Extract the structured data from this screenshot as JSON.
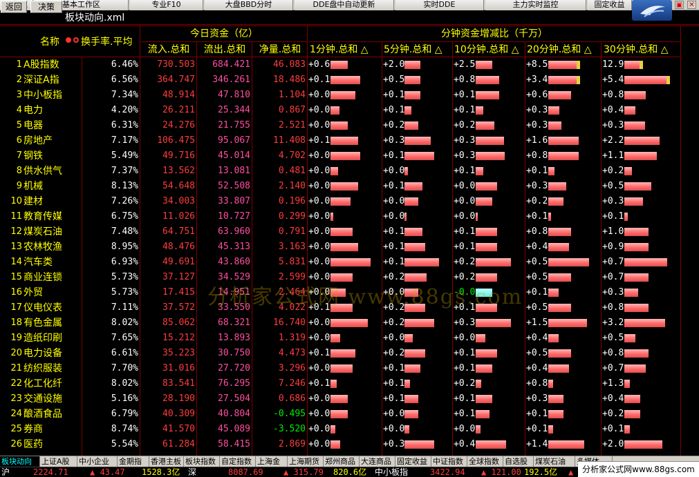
{
  "top_tabs": [
    "工作区",
    "基本工作区",
    "专业F10",
    "大盘BBD分时",
    "DDE盘中自动更新",
    "实时DDE",
    "主力实时监控",
    "固定收益"
  ],
  "toolbar": {
    "back": "返回",
    "strategy": "决策",
    "filename": "板块动向.xml"
  },
  "header": {
    "name": "名称",
    "turnover": "换手率.平均",
    "group_today": "今日资金（亿）",
    "inflow": "流入.总和",
    "outflow": "流出.总和",
    "net": "净量.总和",
    "group_minute": "分钟资金增减比（千万）",
    "m1": "1分钟.总和 △",
    "m5": "5分钟.总和 △",
    "m10": "10分钟.总和 △",
    "m20": "20分钟.总和 △",
    "m30": "30分钟.总和 △"
  },
  "rows": [
    {
      "idx": "1",
      "name": "A股指数",
      "turn": "6.46%",
      "in": "730.503",
      "out": "684.421",
      "net": "46.083",
      "d": [
        "+0.6",
        "+2.0",
        "+2.5",
        "+8.5",
        "12.9"
      ],
      "b": [
        0.35,
        0.35,
        0.35,
        0.62,
        0.35
      ]
    },
    {
      "idx": "2",
      "name": "深证A指",
      "turn": "6.56%",
      "in": "364.747",
      "out": "346.261",
      "net": "18.486",
      "d": [
        "+0.1",
        "+0.5",
        "+0.8",
        "+3.4",
        "+5.4"
      ],
      "b": [
        0.6,
        0.35,
        0.5,
        0.62,
        0.85
      ]
    },
    {
      "idx": "3",
      "name": "中小板指",
      "turn": "7.34%",
      "in": "48.914",
      "out": "47.810",
      "net": "1.104",
      "d": [
        "+0.0",
        "+0.1",
        "+0.1",
        "+0.6",
        "+0.8"
      ],
      "b": [
        0.5,
        0.35,
        0.5,
        0.45,
        0.4
      ]
    },
    {
      "idx": "4",
      "name": "电力",
      "turn": "4.20%",
      "in": "26.211",
      "out": "25.344",
      "net": "0.867",
      "d": [
        "+0.0",
        "+0.1",
        "+0.1",
        "+0.3",
        "+0.4"
      ],
      "b": [
        0.18,
        0.15,
        0.16,
        0.22,
        0.2
      ]
    },
    {
      "idx": "5",
      "name": "电器",
      "turn": "6.31%",
      "in": "24.276",
      "out": "21.755",
      "net": "2.521",
      "d": [
        "+0.0",
        "+0.2",
        "+0.2",
        "+0.3",
        "+0.3"
      ],
      "b": [
        0.35,
        0.3,
        0.4,
        0.25,
        0.38
      ]
    },
    {
      "idx": "6",
      "name": "房地产",
      "turn": "7.17%",
      "in": "106.475",
      "out": "95.067",
      "net": "11.408",
      "d": [
        "+0.1",
        "+0.3",
        "+0.3",
        "+1.6",
        "+2.2"
      ],
      "b": [
        0.55,
        0.58,
        0.6,
        0.6,
        0.65
      ]
    },
    {
      "idx": "7",
      "name": "钢铁",
      "turn": "5.49%",
      "in": "49.716",
      "out": "45.014",
      "net": "4.702",
      "d": [
        "+0.0",
        "+0.1",
        "+0.3",
        "+0.8",
        "+1.1"
      ],
      "b": [
        0.6,
        0.65,
        0.62,
        0.6,
        0.6
      ]
    },
    {
      "idx": "8",
      "name": "供水供气",
      "turn": "7.37%",
      "in": "13.562",
      "out": "13.081",
      "net": "0.481",
      "d": [
        "+0.0",
        "+0.0",
        "+0.1",
        "+0.1",
        "+0.2"
      ],
      "b": [
        0.15,
        0.08,
        0.16,
        0.12,
        0.14
      ]
    },
    {
      "idx": "9",
      "name": "机械",
      "turn": "8.13%",
      "in": "54.648",
      "out": "52.508",
      "net": "2.140",
      "d": [
        "+0.0",
        "+0.1",
        "+0.0",
        "+0.3",
        "+0.5"
      ],
      "b": [
        0.55,
        0.4,
        0.45,
        0.35,
        0.5
      ]
    },
    {
      "idx": "10",
      "name": "建材",
      "turn": "7.26%",
      "in": "34.003",
      "out": "33.807",
      "net": "0.196",
      "d": [
        "+0.0",
        "+0.0",
        "+0.0",
        "+0.2",
        "+0.3"
      ],
      "b": [
        0.4,
        0.3,
        0.35,
        0.3,
        0.35
      ]
    },
    {
      "idx": "11",
      "name": "教育传媒",
      "turn": "6.75%",
      "in": "11.026",
      "out": "10.727",
      "net": "0.299",
      "d": [
        "+0.0",
        "+0.0",
        "+0.0",
        "+0.1",
        "+0.1"
      ],
      "b": [
        0.06,
        0.04,
        0.04,
        0.06,
        0.06
      ]
    },
    {
      "idx": "12",
      "name": "煤炭石油",
      "turn": "7.48%",
      "in": "64.751",
      "out": "63.960",
      "net": "0.791",
      "d": [
        "+0.0",
        "+0.1",
        "+0.1",
        "+0.8",
        "+1.0"
      ],
      "b": [
        0.45,
        0.4,
        0.45,
        0.45,
        0.45
      ]
    },
    {
      "idx": "13",
      "name": "农林牧渔",
      "turn": "8.95%",
      "in": "48.476",
      "out": "45.313",
      "net": "3.163",
      "d": [
        "+0.0",
        "+0.1",
        "+0.1",
        "+0.4",
        "+0.9"
      ],
      "b": [
        0.55,
        0.45,
        0.45,
        0.4,
        0.45
      ]
    },
    {
      "idx": "14",
      "name": "汽车类",
      "turn": "6.93%",
      "in": "49.691",
      "out": "43.860",
      "net": "5.831",
      "d": [
        "+0.0",
        "+0.1",
        "+0.2",
        "+0.5",
        "+0.7"
      ],
      "b": [
        0.8,
        0.75,
        0.75,
        0.8,
        0.8
      ]
    },
    {
      "idx": "15",
      "name": "商业连锁",
      "turn": "5.73%",
      "in": "37.127",
      "out": "34.529",
      "net": "2.599",
      "d": [
        "+0.0",
        "+0.2",
        "+0.2",
        "+0.5",
        "+0.7"
      ],
      "b": [
        0.45,
        0.48,
        0.45,
        0.45,
        0.45
      ]
    },
    {
      "idx": "16",
      "name": "外贸",
      "turn": "5.73%",
      "in": "17.415",
      "out": "14.951",
      "net": "2.464",
      "d": [
        "+0.0",
        "+0.0",
        "-0.0",
        "+0.1",
        "+0.3"
      ],
      "b": [
        0.3,
        0.3,
        0.35,
        0.2,
        0.25
      ]
    },
    {
      "idx": "17",
      "name": "仪电仪表",
      "turn": "7.11%",
      "in": "37.572",
      "out": "33.550",
      "net": "4.022",
      "d": [
        "+0.1",
        "+0.2",
        "+0.1",
        "+0.5",
        "+0.8"
      ],
      "b": [
        0.45,
        0.45,
        0.45,
        0.45,
        0.45
      ]
    },
    {
      "idx": "18",
      "name": "有色金属",
      "turn": "8.02%",
      "in": "85.062",
      "out": "68.321",
      "net": "16.740",
      "d": [
        "+0.0",
        "+0.2",
        "+0.3",
        "+1.5",
        "+3.2"
      ],
      "b": [
        0.75,
        0.65,
        0.75,
        0.75,
        0.75
      ]
    },
    {
      "idx": "19",
      "name": "造纸印刷",
      "turn": "7.65%",
      "in": "15.212",
      "out": "13.893",
      "net": "1.319",
      "d": [
        "+0.0",
        "+0.0",
        "+0.0",
        "+0.4",
        "+0.5"
      ],
      "b": [
        0.2,
        0.18,
        0.2,
        0.2,
        0.2
      ]
    },
    {
      "idx": "20",
      "name": "电力设备",
      "turn": "6.61%",
      "in": "35.223",
      "out": "30.750",
      "net": "4.473",
      "d": [
        "+0.1",
        "+0.2",
        "+0.1",
        "+0.5",
        "+0.8"
      ],
      "b": [
        0.5,
        0.45,
        0.45,
        0.45,
        0.45
      ]
    },
    {
      "idx": "21",
      "name": "纺织服装",
      "turn": "7.70%",
      "in": "31.016",
      "out": "27.720",
      "net": "3.296",
      "d": [
        "+0.0",
        "+0.1",
        "+0.1",
        "+0.4",
        "+0.7"
      ],
      "b": [
        0.45,
        0.35,
        0.35,
        0.4,
        0.4
      ]
    },
    {
      "idx": "22",
      "name": "化工化纤",
      "turn": "8.02%",
      "in": "83.541",
      "out": "76.295",
      "net": "7.246",
      "d": [
        "+0.1",
        "+0.1",
        "+0.2",
        "+0.8",
        "+1.3"
      ],
      "b": [
        0.12,
        0.12,
        0.12,
        0.1,
        0.1
      ]
    },
    {
      "idx": "23",
      "name": "交通设施",
      "turn": "5.16%",
      "in": "28.190",
      "out": "27.504",
      "net": "0.686",
      "d": [
        "+0.0",
        "+0.1",
        "+0.1",
        "+0.3",
        "+0.4"
      ],
      "b": [
        0.35,
        0.3,
        0.35,
        0.3,
        0.3
      ]
    },
    {
      "idx": "24",
      "name": "酿酒食品",
      "turn": "6.79%",
      "in": "40.309",
      "out": "40.804",
      "net": "-0.495",
      "d": [
        "+0.0",
        "+0.0",
        "+0.1",
        "+0.1",
        "+0.2"
      ],
      "b": [
        0.35,
        0.3,
        0.3,
        0.3,
        0.3
      ]
    },
    {
      "idx": "25",
      "name": "券商",
      "turn": "8.74%",
      "in": "41.570",
      "out": "45.089",
      "net": "-3.520",
      "d": [
        "+0.0",
        "+0.0",
        "+0.0",
        "+0.1",
        "+0.1"
      ],
      "b": [
        0.1,
        0.1,
        0.1,
        0.1,
        0.1
      ]
    },
    {
      "idx": "26",
      "name": "医药",
      "turn": "5.54%",
      "in": "61.284",
      "out": "58.415",
      "net": "2.869",
      "d": [
        "+0.0",
        "+0.3",
        "+0.4",
        "+1.4",
        "+2.0"
      ],
      "b": [
        0.2,
        0.65,
        0.65,
        0.7,
        0.7
      ]
    }
  ],
  "watermark": "分析家公式网 www.88gs.com",
  "sheet_tabs": [
    "板块动向",
    "上证A股",
    "中小企业",
    "金期指",
    "香港主板",
    "板块指数",
    "自定指数",
    "上海金",
    "上海期货",
    "郑州商品",
    "大连商品",
    "固定收益",
    "中证指数",
    "全球指数",
    "自选股",
    "煤炭石油",
    "多媒体"
  ],
  "status": {
    "sh_label": "沪",
    "sh_index": "2224.71",
    "sh_change": "▲ 43.47",
    "sh_amount": "1528.3亿",
    "sz_label": "深",
    "sz_index": "8087.69",
    "sz_change": "▲ 315.79",
    "sz_amount": "820.6亿",
    "zx_label": "中小板指",
    "zx_index": "3422.94",
    "zx_change": "▲ 121.00",
    "zx_amount": "192.5亿",
    "tail": "▲ ST"
  },
  "site": "分析家公式网www.88gs.com",
  "colors": {
    "grid_rule": "#800000",
    "name_text": "#ffff00",
    "inflow_text": "#ff3c3c",
    "bar_fill": "#ff8080",
    "negative": "#00ee00"
  }
}
